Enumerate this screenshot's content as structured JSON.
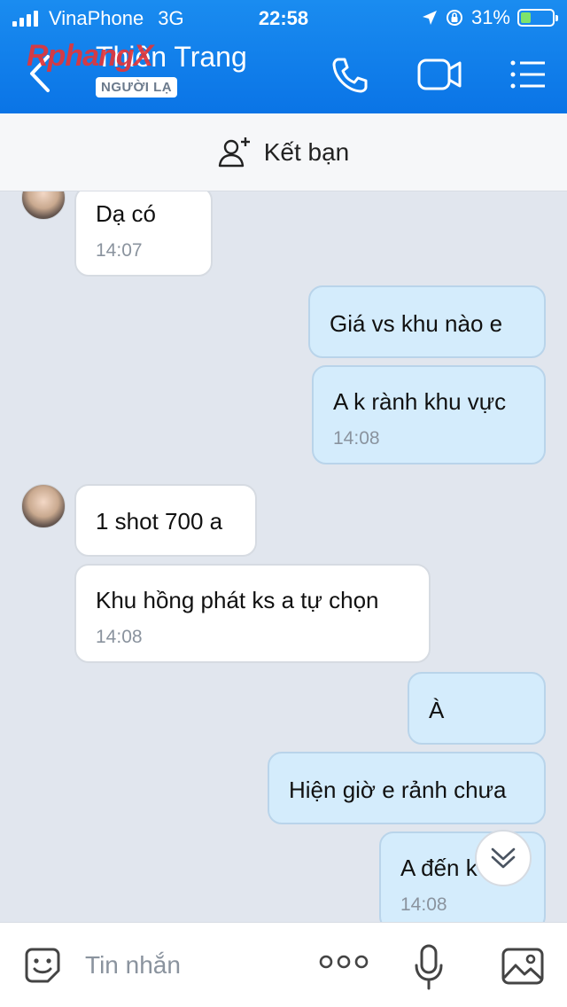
{
  "status_bar": {
    "carrier": "VinaPhone",
    "network": "3G",
    "time": "22:58",
    "battery": "31%"
  },
  "header": {
    "watermark": "Rphang",
    "watermark_tail": "X",
    "chat_name": "Thiên Trang",
    "badge": "NGƯỜI LẠ",
    "icons": [
      "back-icon",
      "phone-icon",
      "video-call-icon",
      "menu-icon"
    ]
  },
  "add_friend": {
    "label": "Kết bạn",
    "icon": "add-user-icon"
  },
  "messages": [
    {
      "dir": "in",
      "text": "Dạ có",
      "time": "14:07"
    },
    {
      "dir": "out",
      "text": "Giá vs khu nào e",
      "time": ""
    },
    {
      "dir": "out",
      "text": "A k rành khu vực",
      "time": "14:08"
    },
    {
      "dir": "in",
      "text": "1 shot 700 a",
      "time": ""
    },
    {
      "dir": "in",
      "text": "Khu hồng phát ks a tự chọn",
      "time": "14:08"
    },
    {
      "dir": "out",
      "text": "À",
      "time": ""
    },
    {
      "dir": "out",
      "text": "Hiện giờ e rảnh chưa",
      "time": ""
    },
    {
      "dir": "out",
      "text": "A đến k",
      "time": "14:08"
    }
  ],
  "input": {
    "placeholder": "Tin nhắn",
    "icons": [
      "sticker-icon",
      "more-icon",
      "microphone-icon",
      "image-icon"
    ]
  },
  "colors": {
    "header": "#0a74e6",
    "outgoing_bubble": "#d4ecfc",
    "incoming_bubble": "#ffffff",
    "chat_background": "#e1e6ee"
  }
}
